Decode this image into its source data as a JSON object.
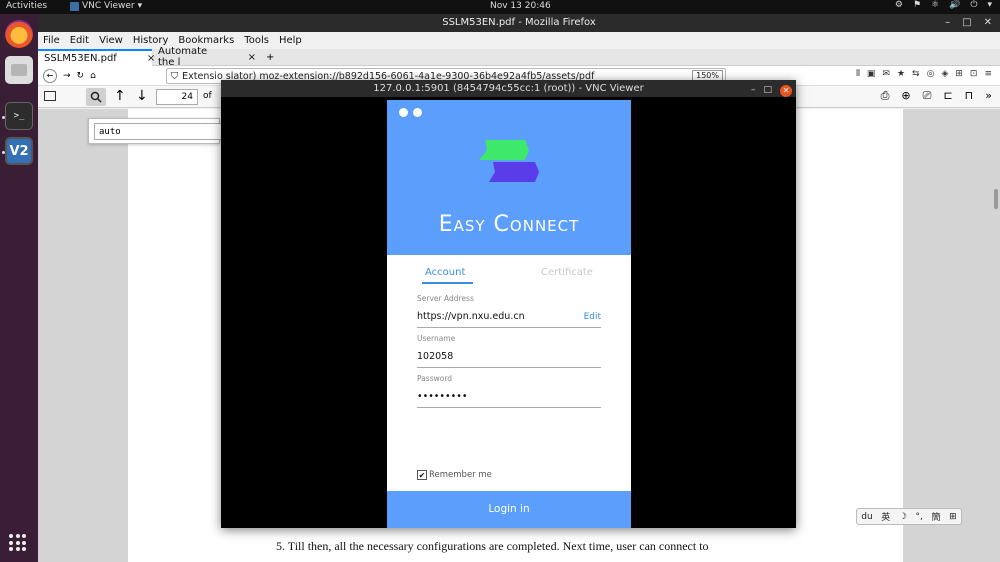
{
  "topbar": {
    "activities": "Activities",
    "app_name": "VNC Viewer",
    "app_arrow": "▾",
    "clock": "Nov 13  20:46",
    "tray": [
      "⚙",
      "⚑",
      "⚛",
      "🔊",
      "⏻",
      "▾"
    ]
  },
  "firefox": {
    "window_title": "SSLM53EN.pdf - Mozilla Firefox",
    "controls": [
      "–",
      "□",
      "✕"
    ],
    "menu": [
      "File",
      "Edit",
      "View",
      "History",
      "Bookmarks",
      "Tools",
      "Help"
    ],
    "tabs": [
      {
        "label": "SSLM53EN.pdf",
        "close": "×"
      },
      {
        "label": "Automate the l",
        "close": "×"
      }
    ],
    "new_tab": "+",
    "url_text": "Extensio slator) moz-extension://b892d156-6061-4a1e-9300-36b4e92a4fb5/assets/pdf",
    "zoom": "150%",
    "nav_icons": [
      "←",
      "→",
      "↻",
      "⌂"
    ],
    "right_icons": [
      "⫴",
      "▣",
      "✉",
      "★",
      "⇆",
      "◎",
      "◈",
      "⊞",
      "⊡",
      "≡"
    ]
  },
  "pdf": {
    "page_number": "24",
    "of_label": "of",
    "find_value": "auto",
    "right_tools": [
      "⎙",
      "⊕",
      "⎚",
      "⊏",
      "⊓",
      "»"
    ],
    "visible_text": "5.    Till then, all the necessary configurations are completed. Next time, user can connect to"
  },
  "ime": [
    "du",
    "英",
    "☽",
    "°,",
    "簡",
    "⊞"
  ],
  "vnc": {
    "title": "127.0.0.1:5901 (8454794c55cc:1 (root)) - VNC Viewer",
    "controls": [
      "–",
      "□"
    ],
    "close": "✕"
  },
  "app": {
    "brand": "Easy Connect",
    "tab_account": "Account",
    "tab_certificate": "Certificate",
    "server_label": "Server Address",
    "server_value": "https://vpn.nxu.edu.cn",
    "edit_label": "Edit",
    "username_label": "Username",
    "username_value": "102058",
    "password_label": "Password",
    "password_value": "•••••••••",
    "remember_label": "Remember me",
    "remember_check": "✔",
    "login_label": "Login in"
  },
  "colors": {
    "accent_blue": "#5c9efc",
    "logo_green": "#3ee86a",
    "logo_purple": "#5a3ce8"
  }
}
